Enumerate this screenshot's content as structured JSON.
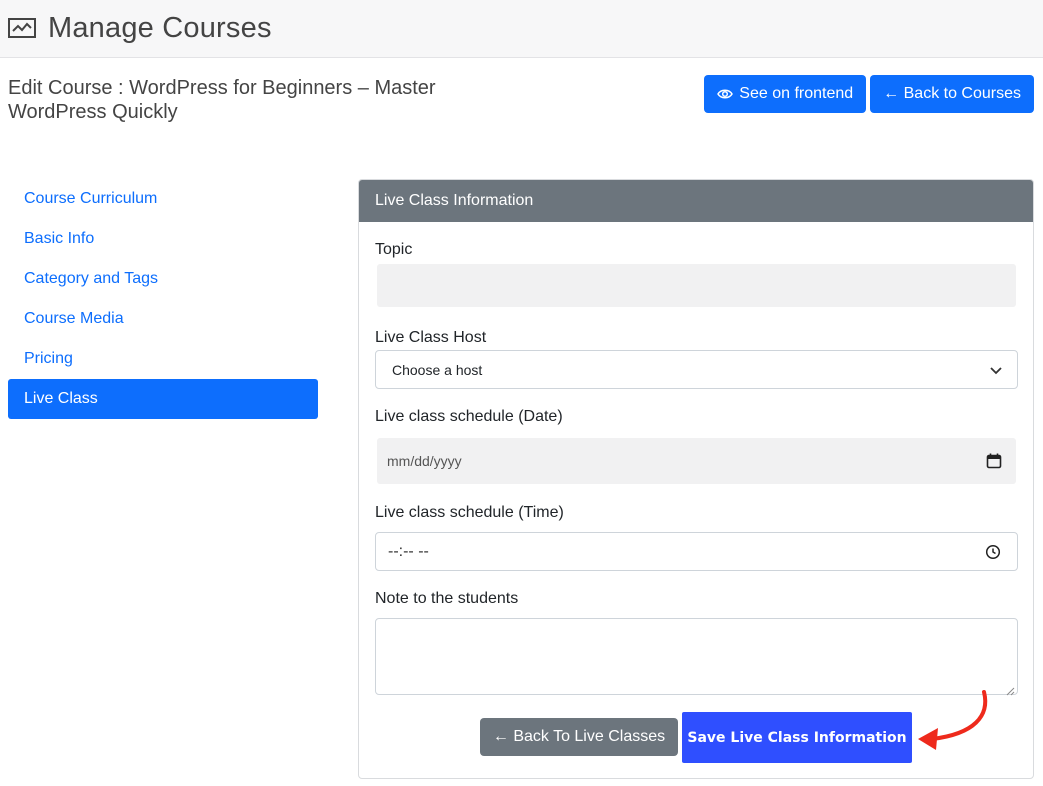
{
  "header": {
    "title": "Manage Courses",
    "icon": "chart-icon"
  },
  "edit": {
    "title": "Edit Course : WordPress for Beginners – Master WordPress Quickly",
    "see_frontend": "See on frontend",
    "back_courses": "← Back to Courses"
  },
  "sidebar": {
    "items": [
      {
        "label": "Course Curriculum",
        "active": false
      },
      {
        "label": "Basic Info",
        "active": false
      },
      {
        "label": "Category and Tags",
        "active": false
      },
      {
        "label": "Course Media",
        "active": false
      },
      {
        "label": "Pricing",
        "active": false
      },
      {
        "label": "Live Class",
        "active": true
      }
    ]
  },
  "card": {
    "header": "Live Class Information",
    "topic_label": "Topic",
    "host_label": "Live Class Host",
    "host_value": "Choose a host",
    "date_label": "Live class schedule (Date)",
    "date_placeholder": "mm/dd/yyyy",
    "time_label": "Live class schedule (Time)",
    "time_placeholder": "--:-- --",
    "note_label": "Note to the students",
    "back_button": "← Back To Live Classes",
    "save_button": "Save Live Class Information"
  },
  "colors": {
    "primary": "#0d6efd",
    "secondary": "#6c757d",
    "save": "#2f4fff",
    "annotation_arrow": "#ee2a1c"
  }
}
